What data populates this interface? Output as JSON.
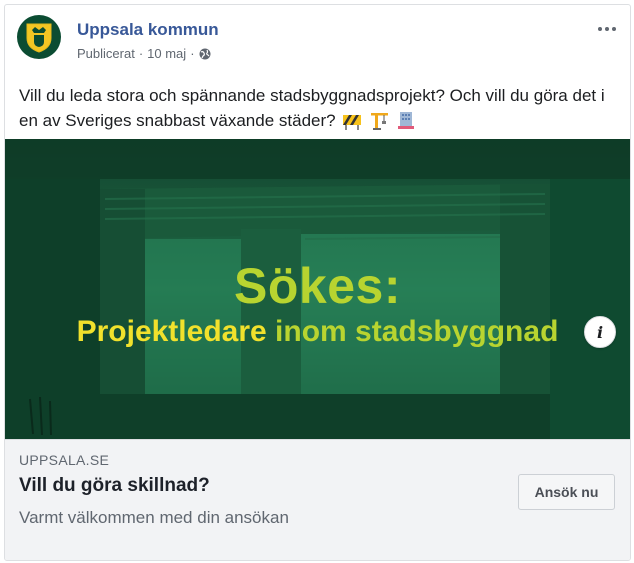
{
  "post": {
    "page_name": "Uppsala kommun",
    "published_label": "Publicerat",
    "date": "10 maj",
    "separator": "·",
    "text": "Vill du leda stora och spännande stadsbyggnadsprojekt? Och vill du göra det i en av Sveriges snabbast växande städer?",
    "emojis": [
      "construction-sign",
      "crane",
      "office-building"
    ]
  },
  "ad_image": {
    "headline": "Sökes:",
    "subheadline_part1": "Projektledare",
    "subheadline_part2": "inom stadsbyggnad"
  },
  "link": {
    "domain": "UPPSALA.SE",
    "title": "Vill du göra skillnad?",
    "description": "Varmt välkommen med din ansökan",
    "cta_label": "Ansök nu"
  },
  "colors": {
    "page_name": "#385898",
    "image_overlay": "#0f5a3a",
    "headline_green": "#b8d430",
    "headline_yellow": "#f1e12c"
  },
  "icons": [
    "crest-icon",
    "globe-icon",
    "more-icon",
    "info-icon"
  ]
}
